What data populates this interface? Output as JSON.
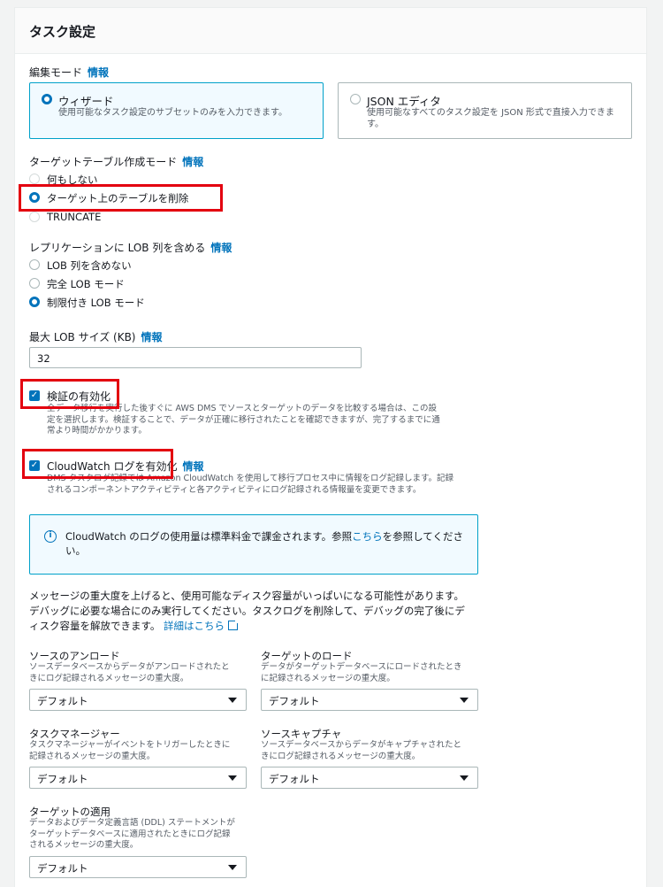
{
  "panel": {
    "title": "タスク設定"
  },
  "edit_mode": {
    "label": "編集モード",
    "info": "情報",
    "wizard": {
      "title": "ウィザード",
      "desc": "使用可能なタスク設定のサブセットのみを入力できます。"
    },
    "json": {
      "title": "JSON エディタ",
      "desc": "使用可能なすべてのタスク設定を JSON 形式で直接入力できます。"
    }
  },
  "target_table": {
    "label": "ターゲットテーブル作成モード",
    "info": "情報",
    "options": [
      "何もしない",
      "ターゲット上のテーブルを削除",
      "TRUNCATE"
    ]
  },
  "lob": {
    "label": "レプリケーションに LOB 列を含める",
    "info": "情報",
    "options": [
      "LOB 列を含めない",
      "完全 LOB モード",
      "制限付き LOB モード"
    ]
  },
  "max_lob": {
    "label": "最大 LOB サイズ (KB)",
    "info": "情報",
    "value": "32"
  },
  "validation": {
    "label": "検証の有効化",
    "desc_1": "全データ移行を実行した後すぐに AWS DMS でソースとターゲットのデータを比較する場合は、この設",
    "desc_2": "定を選択します。検証することで、データが正確に移行されたことを確認できますが、完了するまでに通",
    "desc_3": "常より時間がかかります。"
  },
  "cloudwatch": {
    "label": "CloudWatch ログを有効化",
    "info": "情報",
    "desc_1": "DMS タスクログ記録では Amazon CloudWatch を使用して移行プロセス中に情報をログ記録します。記録",
    "desc_2": "されるコンポーネントアクティビティと各アクティビティにログ記録される情報量を変更できます。"
  },
  "alert": {
    "text_pre": "CloudWatch のログの使用量は標準料金で課金されます。参照",
    "link": "こちら",
    "text_post": "を参照してください。"
  },
  "warning": {
    "line_1": "メッセージの重大度を上げると、使用可能なディスク容量がいっぱいになる可能性があります。",
    "line_2": "デバッグに必要な場合にのみ実行してください。タスクログを削除して、デバッグの完了後にデ",
    "line_3": "ィスク容量を解放できます。",
    "link": "詳細はこちら"
  },
  "logs": {
    "source_unload": {
      "title": "ソースのアンロード",
      "desc_1": "ソースデータベースからデータがアンロードされたと",
      "desc_2": "きにログ記録されるメッセージの重大度。",
      "value": "デフォルト"
    },
    "target_load": {
      "title": "ターゲットのロード",
      "desc_1": "データがターゲットデータベースにロードされたとき",
      "desc_2": "に記録されるメッセージの重大度。",
      "value": "デフォルト"
    },
    "task_manager": {
      "title": "タスクマネージャー",
      "desc_1": "タスクマネージャーがイベントをトリガーしたときに",
      "desc_2": "記録されるメッセージの重大度。",
      "value": "デフォルト"
    },
    "source_capture": {
      "title": "ソースキャプチャ",
      "desc_1": "ソースデータベースからデータがキャプチャされたと",
      "desc_2": "きにログ記録されるメッセージの重大度。",
      "value": "デフォルト"
    },
    "target_apply": {
      "title": "ターゲットの適用",
      "desc_1": "データおよびデータ定義言語 (DDL) ステートメントが",
      "desc_2": "ターゲットデータベースに適用されたときにログ記録",
      "desc_3": "されるメッセージの重大度。",
      "value": "デフォルト"
    }
  },
  "colors": {
    "accent": "#0073bb",
    "highlight": "#e3000f"
  }
}
